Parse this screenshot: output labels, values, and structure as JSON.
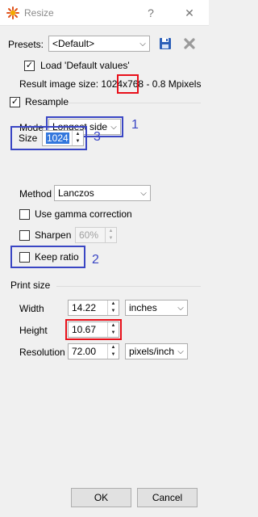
{
  "window": {
    "title": "Resize",
    "help_glyph": "?",
    "close_glyph": "✕"
  },
  "presets": {
    "label": "Presets:",
    "selected": "<Default>",
    "load_defaults_label": "Load 'Default values'",
    "load_defaults_checked": true
  },
  "result": {
    "prefix": "Result image size: 1024",
    "separator": "x",
    "height": "768",
    "suffix": " - 0.8 Mpixels"
  },
  "resample": {
    "label": "Resample",
    "checked": true,
    "mode_label": "Mode",
    "mode_value": "Longest side",
    "size_label": "Size",
    "size_value": "1024",
    "method_label": "Method",
    "method_value": "Lanczos",
    "gamma_label": "Use gamma correction",
    "sharpen_label": "Sharpen",
    "sharpen_value": "60%",
    "keep_ratio_label": "Keep ratio"
  },
  "print_size": {
    "label": "Print size",
    "width_label": "Width",
    "width_value": "14.22",
    "width_unit": "inches",
    "height_label": "Height",
    "height_value": "10.67",
    "resolution_label": "Resolution",
    "resolution_value": "72.00",
    "resolution_unit": "pixels/inch"
  },
  "annotations": {
    "one": "1",
    "two": "2",
    "three": "3"
  },
  "buttons": {
    "ok": "OK",
    "cancel": "Cancel"
  },
  "colors": {
    "annotation_red": "#e8101a",
    "annotation_blue": "#3a46c4",
    "save_icon": "#2b5fb8"
  },
  "icons": {
    "app": "xnview-icon",
    "save": "floppy-disk-icon",
    "delete": "delete-x-icon"
  }
}
